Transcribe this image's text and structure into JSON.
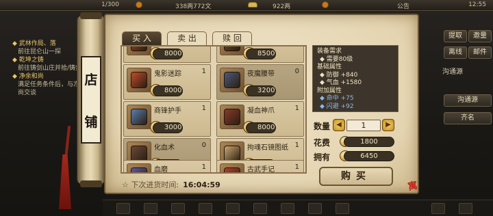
{
  "top_bar": {
    "vip_text": "",
    "stamina": "1/300",
    "money": "338两772文",
    "ingots": "922两",
    "notice": "公告",
    "time": "12:55"
  },
  "quests": [
    {
      "title": "◆ 武林作局、落",
      "sub": "前往昆仑山一探"
    },
    {
      "title": "◆ 乾坤之铸",
      "sub": "前往铸剑山庄并拾/铸剑"
    },
    {
      "title": "◆ 净余和尚",
      "sub": "满足任务条件后，与净余和尚交谈"
    }
  ],
  "right_panel": {
    "btn_invite": "提取",
    "btn_friend": "邀量",
    "btn_rank": "离线",
    "btn_mail": "邮件",
    "text1": "沟通源",
    "text2": "沟通源",
    "text3": "齐名"
  },
  "shop": {
    "plaque_chars": [
      "店",
      "铺"
    ],
    "tabs": [
      "买 入",
      "卖 出",
      "赎 回"
    ],
    "coin_char": "币",
    "items": [
      {
        "name": "",
        "count": "",
        "price": "8000",
        "color": "#a8482a"
      },
      {
        "name": "",
        "count": "",
        "price": "8500",
        "color": "#7a4a28"
      },
      {
        "name": "鬼影迷踪",
        "count": "1",
        "price": "8000",
        "color": "#c24b2a"
      },
      {
        "name": "夜魔腰带",
        "count": "0",
        "price": "3200",
        "color": "#4a5b7a"
      },
      {
        "name": "商锋护手",
        "count": "1",
        "price": "3000",
        "color": "#5a7fb0"
      },
      {
        "name": "凝血神爪",
        "count": "1",
        "price": "8000",
        "color": "#8a3a2a"
      },
      {
        "name": "化血术",
        "count": "0",
        "price": "8000",
        "color": "#6a4a38"
      },
      {
        "name": "拘魂石镜图纸",
        "count": "1",
        "price": "3000",
        "color": "#c9a870"
      },
      {
        "name": "血磨",
        "count": "1",
        "price": "",
        "color": "#5a5aa0"
      },
      {
        "name": "古武手记",
        "count": "1",
        "price": "",
        "color": "#b0412a"
      }
    ],
    "restock_label": "☆ 下次进货时间:",
    "restock_time": "16:04:59",
    "detail": {
      "req_header": "装备需求",
      "req_level": "◆ 需要80级",
      "base_header": "基础属性",
      "base_attrs": [
        "◆ 防御   +840",
        "◆ 气血   +1580"
      ],
      "extra_header": "附加属性",
      "extra_attrs": [
        "◆ 命中   +75",
        "◆ 闪避   +92"
      ]
    },
    "qty_label": "数量",
    "qty_value": "1",
    "cost_label": "花费",
    "cost_value": "1800",
    "own_label": "拥有",
    "own_value": "6450",
    "buy_label": "购买",
    "seal_text": "寓"
  }
}
